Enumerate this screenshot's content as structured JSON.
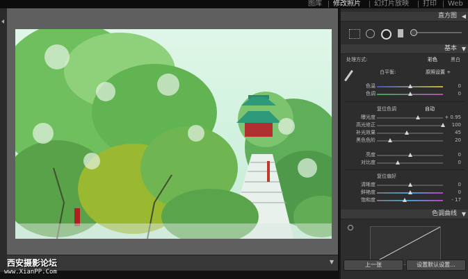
{
  "menu": {
    "items": [
      "图库",
      "修改照片",
      "幻灯片放映",
      "打印",
      "Web"
    ],
    "active": "修改照片"
  },
  "watermark": {
    "name": "西安摄影论坛",
    "url": "www.XianPP.Com"
  },
  "panel": {
    "histogram_title": "直方图",
    "basic_title": "基本",
    "treatment": {
      "label": "处理方式:",
      "color": "彩色",
      "bw": "黑白"
    },
    "wb": {
      "label": "白平衡:",
      "value": "原照设置 ÷"
    },
    "temp": {
      "label": "色温",
      "value": "0",
      "pos": 0.5
    },
    "tint": {
      "label": "色调",
      "value": "0",
      "pos": 0.5
    },
    "tone": {
      "label": "复位色调",
      "auto": "自动"
    },
    "exposure": {
      "label": "曝光度",
      "value": "+ 0.95",
      "pos": 0.62
    },
    "recovery": {
      "label": "高光修正",
      "value": "100",
      "pos": 1.0
    },
    "fill": {
      "label": "补光效果",
      "value": "45",
      "pos": 0.45
    },
    "blacks": {
      "label": "黑色色阶",
      "value": "20",
      "pos": 0.2
    },
    "brightness": {
      "label": "亮度",
      "value": "0",
      "pos": 0.5
    },
    "contrast": {
      "label": "对比度",
      "value": "0",
      "pos": 0.32
    },
    "presence": {
      "label": "复位偏好"
    },
    "clarity": {
      "label": "清晰度",
      "value": "0",
      "pos": 0.5
    },
    "vibrance": {
      "label": "鲜艳度",
      "value": "0",
      "pos": 0.5
    },
    "saturation": {
      "label": "饱和度",
      "value": "- 17",
      "pos": 0.42
    },
    "curve_title": "色调曲线",
    "prev_btn": "上一张",
    "reset_btn": "设置默认设置..."
  },
  "colors": {
    "accent": "#d8d8d8",
    "panel": "#2d2d2d",
    "viewer": "#5f5f5f"
  }
}
